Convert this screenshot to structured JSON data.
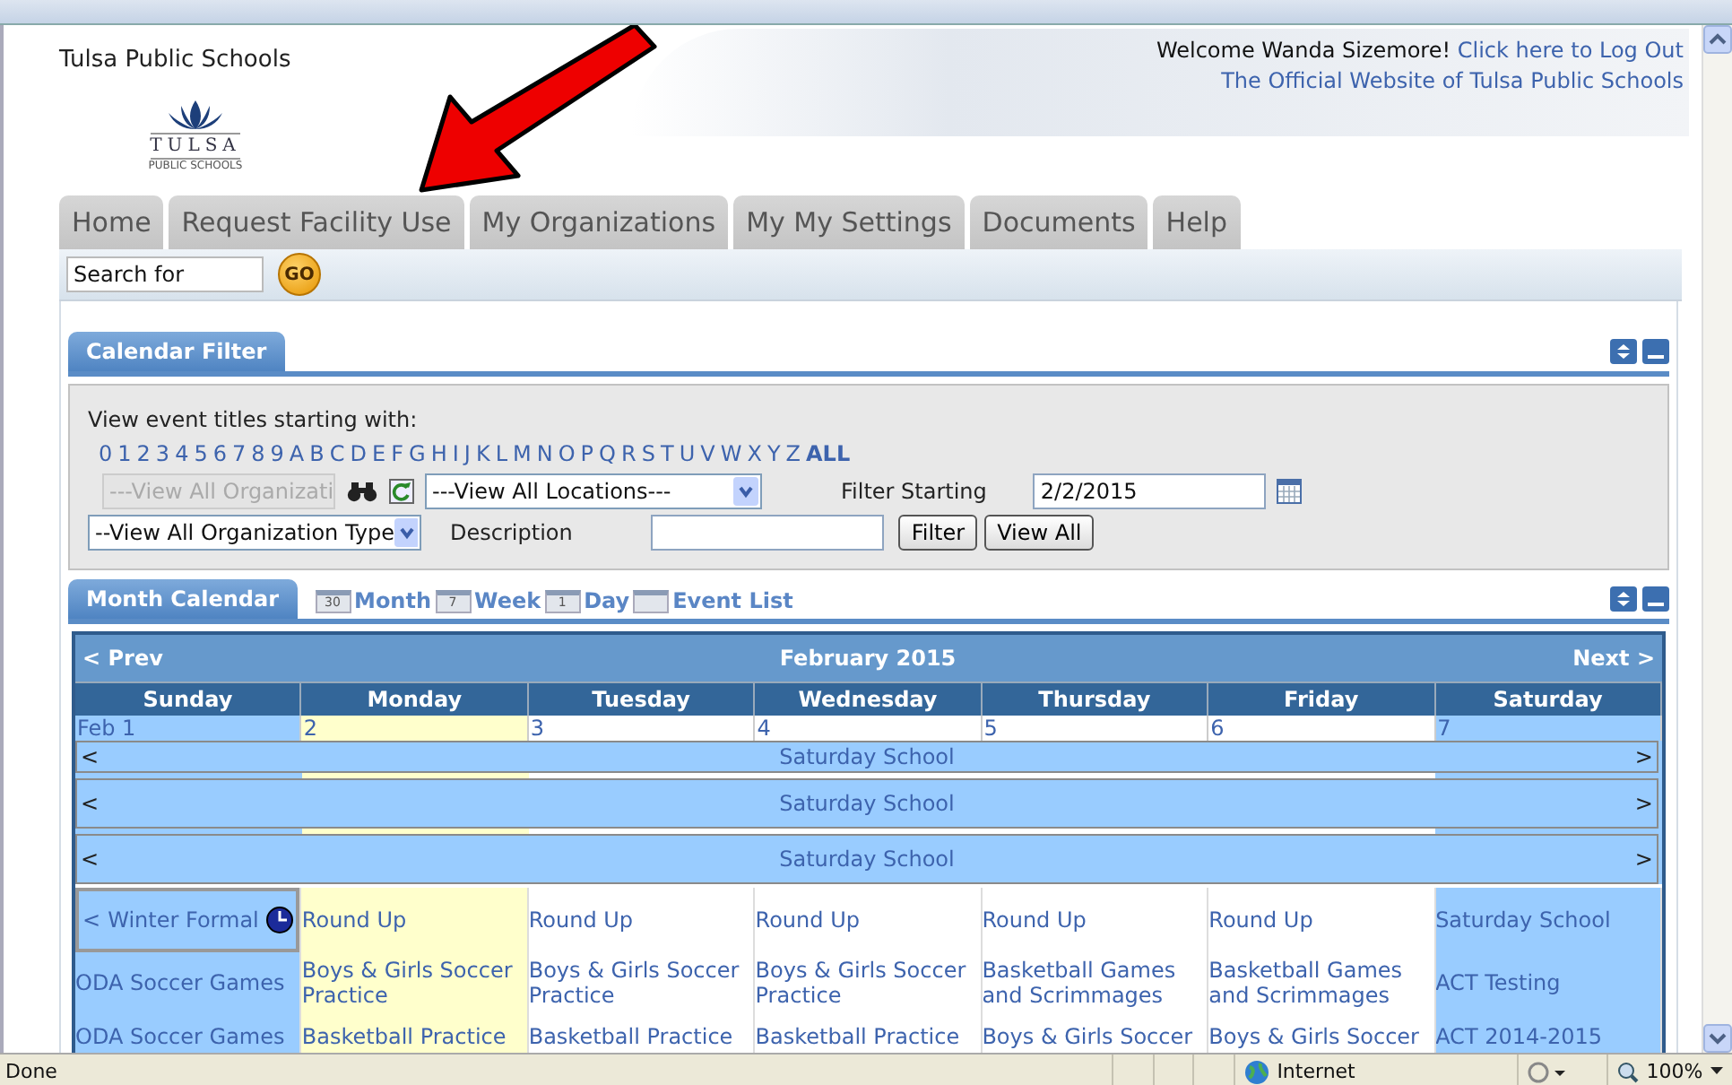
{
  "browser": {
    "status": "Done",
    "zone": "Internet",
    "zoom": "100%"
  },
  "header": {
    "site_name": "Tulsa Public Schools",
    "logo_text": "TULSA",
    "logo_subtext": "PUBLIC SCHOOLS",
    "welcome": "Welcome Wanda Sizemore!",
    "logout_link": "Click here to Log Out",
    "official_link": "The Official Website of Tulsa Public Schools"
  },
  "tabs": [
    {
      "label": "Home",
      "selected": false
    },
    {
      "label": "Request Facility Use",
      "selected": false
    },
    {
      "label": "My Organizations",
      "selected": false
    },
    {
      "label": "My My Settings",
      "selected": false
    },
    {
      "label": "Documents",
      "selected": false
    },
    {
      "label": "Help",
      "selected": false
    }
  ],
  "search": {
    "value": "Search for",
    "button": "GO"
  },
  "calendar_filter": {
    "title": "Calendar Filter",
    "prompt": "View event titles starting with:",
    "letters": [
      "0",
      "1",
      "2",
      "3",
      "4",
      "5",
      "6",
      "7",
      "8",
      "9",
      "A",
      "B",
      "C",
      "D",
      "E",
      "F",
      "G",
      "H",
      "I",
      "J",
      "K",
      "L",
      "M",
      "N",
      "O",
      "P",
      "Q",
      "R",
      "S",
      "T",
      "U",
      "V",
      "W",
      "X",
      "Y",
      "Z"
    ],
    "all_link": "ALL",
    "organization": {
      "value": "---View All Organizati",
      "disabled": true
    },
    "location": "---View All Locations---",
    "date_label": "Filter Starting",
    "date": "2/2/2015",
    "org_type": "--View All Organization Type",
    "description_label": "Description",
    "buttons": [
      "Filter",
      "View All"
    ]
  },
  "month_calendar": {
    "title": "Month Calendar",
    "views": [
      {
        "label": "Month",
        "icon_text": "30"
      },
      {
        "label": "Week",
        "icon_text": "7"
      },
      {
        "label": "Day",
        "icon_text": "1"
      },
      {
        "label": "Event List"
      }
    ]
  },
  "calendar": {
    "prev": "< Prev",
    "title": "February 2015",
    "next": "Next >",
    "days": [
      {
        "name": "Sunday",
        "date": "Feb 1",
        "kind": "weekend"
      },
      {
        "name": "Monday",
        "date": "2",
        "kind": "today"
      },
      {
        "name": "Tuesday",
        "date": "3",
        "kind": "weekday"
      },
      {
        "name": "Wednesday",
        "date": "4",
        "kind": "weekday"
      },
      {
        "name": "Thursday",
        "date": "5",
        "kind": "weekday"
      },
      {
        "name": "Friday",
        "date": "6",
        "kind": "weekday"
      },
      {
        "name": "Saturday",
        "date": "7",
        "kind": "weekend"
      }
    ],
    "bars": [
      {
        "left": "<",
        "title": "Saturday School",
        "right": ">"
      },
      {
        "left": "<",
        "title": "Saturday School",
        "right": ">"
      },
      {
        "left": "<",
        "title": "Saturday School",
        "right": ">"
      }
    ],
    "events": [
      [
        {
          "kind": "continued",
          "prefix": "<",
          "title": "Winter Formal"
        },
        {
          "kind": "plain",
          "title": "ODA Soccer Games"
        },
        {
          "kind": "plain",
          "title": "ODA Soccer Games"
        }
      ],
      [
        {
          "kind": "plain",
          "title": "Round Up"
        },
        {
          "kind": "plain",
          "title": "Boys & Girls Soccer Practice"
        },
        {
          "kind": "plain",
          "title": "Basketball Practice"
        }
      ],
      [
        {
          "kind": "plain",
          "title": "Round Up"
        },
        {
          "kind": "plain",
          "title": "Boys & Girls Soccer Practice"
        },
        {
          "kind": "plain",
          "title": "Basketball Practice"
        }
      ],
      [
        {
          "kind": "plain",
          "title": "Round Up"
        },
        {
          "kind": "plain",
          "title": "Boys & Girls Soccer Practice"
        },
        {
          "kind": "plain",
          "title": "Basketball Practice"
        }
      ],
      [
        {
          "kind": "plain",
          "title": "Round Up"
        },
        {
          "kind": "plain",
          "title": "Basketball Games and Scrimmages"
        },
        {
          "kind": "plain",
          "title": "Boys & Girls Soccer"
        }
      ],
      [
        {
          "kind": "plain",
          "title": "Round Up"
        },
        {
          "kind": "plain",
          "title": "Basketball Games and Scrimmages"
        },
        {
          "kind": "plain",
          "title": "Boys & Girls Soccer"
        }
      ],
      [
        {
          "kind": "plain",
          "title": "Saturday School"
        },
        {
          "kind": "plain",
          "title": "ACT Testing"
        },
        {
          "kind": "plain",
          "title": "ACT 2014-2015"
        }
      ]
    ]
  }
}
